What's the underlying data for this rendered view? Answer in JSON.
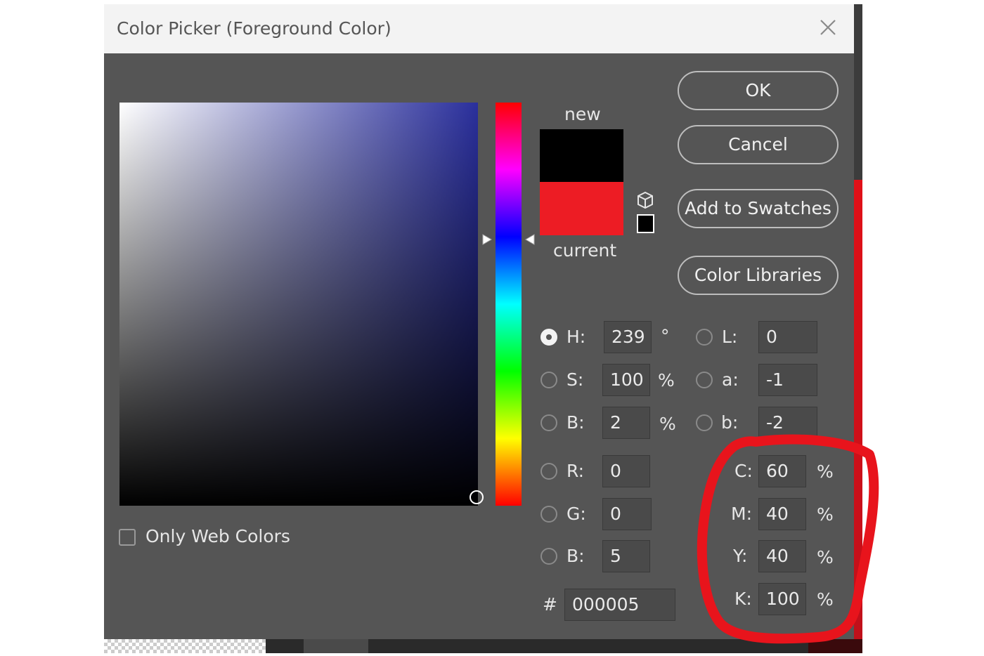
{
  "dialog": {
    "title": "Color Picker (Foreground Color)",
    "close_icon": "close-icon"
  },
  "preview": {
    "new_label": "new",
    "current_label": "current",
    "new_color": "#000000",
    "current_color": "#ed1c24"
  },
  "buttons": {
    "ok": "OK",
    "cancel": "Cancel",
    "add_to_swatches": "Add to Swatches",
    "color_libraries": "Color Libraries"
  },
  "hsb": {
    "h_label": "H:",
    "h_value": "239",
    "h_unit": "°",
    "s_label": "S:",
    "s_value": "100",
    "s_unit": "%",
    "b_label": "B:",
    "b_value": "2",
    "b_unit": "%",
    "selected": "H"
  },
  "rgb": {
    "r_label": "R:",
    "r_value": "0",
    "g_label": "G:",
    "g_value": "0",
    "b_label": "B:",
    "b_value": "5"
  },
  "lab": {
    "l_label": "L:",
    "l_value": "0",
    "a_label": "a:",
    "a_value": "-1",
    "b_label": "b:",
    "b_value": "-2"
  },
  "cmyk": {
    "c_label": "C:",
    "c_value": "60",
    "c_unit": "%",
    "m_label": "M:",
    "m_value": "40",
    "m_unit": "%",
    "y_label": "Y:",
    "y_value": "40",
    "y_unit": "%",
    "k_label": "K:",
    "k_value": "100",
    "k_unit": "%"
  },
  "hex": {
    "label": "#",
    "value": "000005"
  },
  "options": {
    "only_web_colors": "Only Web Colors",
    "only_web_colors_checked": false
  },
  "colors": {
    "dialog_bg": "#555555",
    "titlebar_bg": "#f3f3f3",
    "annotation_red": "#e8141c",
    "hue_base": "#2a2f9c"
  },
  "icons": [
    "close-icon",
    "cube-icon",
    "web-safe-swatch-icon",
    "slider-arrow-icon"
  ]
}
